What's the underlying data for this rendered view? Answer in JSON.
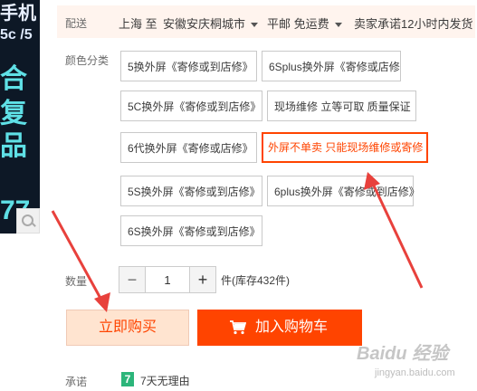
{
  "banner": {
    "lines": [
      "手机",
      "5c /5",
      "合",
      "复",
      "品",
      "77"
    ]
  },
  "shipping": {
    "label": "配送",
    "from": "上海 至",
    "to": "安徽安庆桐城市",
    "fee": "平邮 免运费",
    "promise": "卖家承诺12小时内发货"
  },
  "color": {
    "label": "颜色分类",
    "options": [
      "5换外屏《寄修或到店修》",
      "6Splus换外屏《寄修或店修",
      "5C换外屏《寄修或到店修》",
      "现场维修 立等可取 质量保证",
      "6代换外屏《寄修或店修》",
      "外屏不单卖 只能现场维修或寄修",
      "5S换外屏《寄修或到店修》",
      "6plus换外屏《寄修或到店修》",
      "6S换外屏《寄修或到店修》"
    ],
    "selected_index": 5
  },
  "quantity": {
    "label": "数量",
    "minus": "−",
    "value": "1",
    "plus": "+",
    "stock_text": "件(库存432件)"
  },
  "actions": {
    "buy_now": "立即购买",
    "add_to_cart": "加入购物车"
  },
  "promise": {
    "label": "承诺",
    "badge": "7",
    "text": "7天无理由"
  },
  "watermark": {
    "top": "Baidu 经验",
    "bottom": "jingyan.baidu.com"
  },
  "colors": {
    "accent": "#ff4400",
    "buy_bg": "#ffe4d0",
    "ship_bg": "#fff4ee",
    "annotation_arrow": "#e8413c",
    "badge_green": "#2cb57a"
  }
}
